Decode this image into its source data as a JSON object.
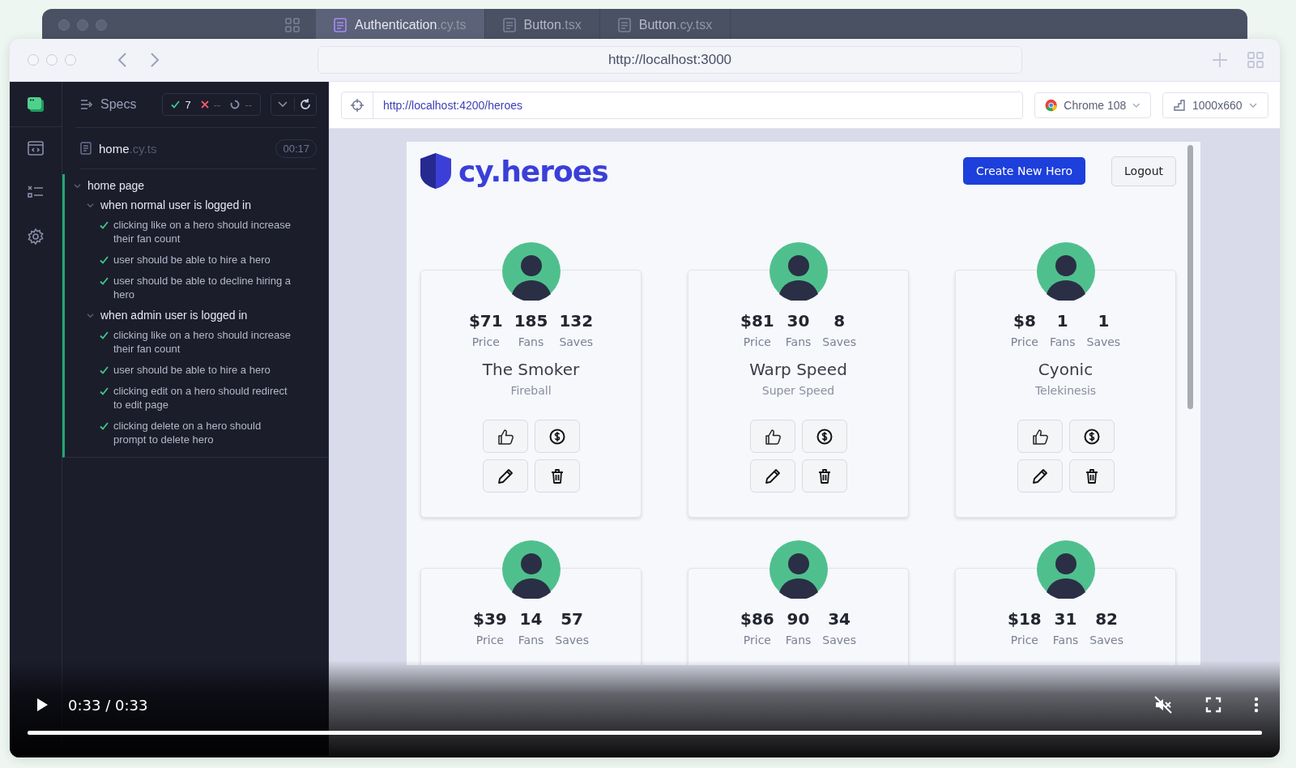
{
  "back_window": {
    "tabs": [
      {
        "name": "Authentication",
        "ext": ".cy.ts",
        "selected": true
      },
      {
        "name": "Button",
        "ext": ".tsx",
        "selected": false
      },
      {
        "name": "Button",
        "ext": ".cy.tsx",
        "selected": false
      }
    ]
  },
  "browser": {
    "address": "http://localhost:3000"
  },
  "specs_panel": {
    "title": "Specs",
    "stats": {
      "passed": "7",
      "failed": "--",
      "pending": "--"
    },
    "spec_file": {
      "name": "home",
      "ext": ".cy.ts",
      "duration": "00:17"
    },
    "tests": [
      {
        "title": "home page",
        "expanded": true,
        "children": [
          {
            "title": "when normal user is logged in",
            "expanded": true,
            "children": [
              {
                "title": "clicking like on a hero should increase their fan count",
                "passed": true
              },
              {
                "title": "user should be able to hire a hero",
                "passed": true
              },
              {
                "title": "user should be able to decline hiring a hero",
                "passed": true
              }
            ]
          },
          {
            "title": "when admin user is logged in",
            "expanded": true,
            "children": [
              {
                "title": "clicking like on a hero should increase their fan count",
                "passed": true
              },
              {
                "title": "user should be able to hire a hero",
                "passed": true
              },
              {
                "title": "clicking edit on a hero should redirect to edit page",
                "passed": true
              },
              {
                "title": "clicking delete on a hero should prompt to delete hero",
                "passed": true
              }
            ]
          }
        ]
      }
    ]
  },
  "runner": {
    "url": "http://localhost:4200/heroes",
    "browser": "Chrome 108",
    "viewport": "1000x660"
  },
  "app": {
    "logo": "cy.heroes",
    "buttons": [
      {
        "label": "Create New Hero",
        "kind": "primary"
      },
      {
        "label": "Logout",
        "kind": "secondary"
      }
    ],
    "heroes": [
      {
        "stats": [
          {
            "value": "$71",
            "label": "Price"
          },
          {
            "value": "185",
            "label": "Fans"
          },
          {
            "value": "132",
            "label": "Saves"
          }
        ],
        "name": "The Smoker",
        "power": "Fireball"
      },
      {
        "stats": [
          {
            "value": "$81",
            "label": "Price"
          },
          {
            "value": "30",
            "label": "Fans"
          },
          {
            "value": "8",
            "label": "Saves"
          }
        ],
        "name": "Warp Speed",
        "power": "Super Speed"
      },
      {
        "stats": [
          {
            "value": "$8",
            "label": "Price"
          },
          {
            "value": "1",
            "label": "Fans"
          },
          {
            "value": "1",
            "label": "Saves"
          }
        ],
        "name": "Cyonic",
        "power": "Telekinesis"
      },
      {
        "stats": [
          {
            "value": "$39",
            "label": "Price"
          },
          {
            "value": "14",
            "label": "Fans"
          },
          {
            "value": "57",
            "label": "Saves"
          }
        ]
      },
      {
        "stats": [
          {
            "value": "$86",
            "label": "Price"
          },
          {
            "value": "90",
            "label": "Fans"
          },
          {
            "value": "34",
            "label": "Saves"
          }
        ]
      },
      {
        "stats": [
          {
            "value": "$18",
            "label": "Price"
          },
          {
            "value": "31",
            "label": "Fans"
          },
          {
            "value": "82",
            "label": "Saves"
          }
        ]
      }
    ]
  },
  "video": {
    "time": "0:33 / 0:33",
    "muted": true,
    "level": 1
  }
}
